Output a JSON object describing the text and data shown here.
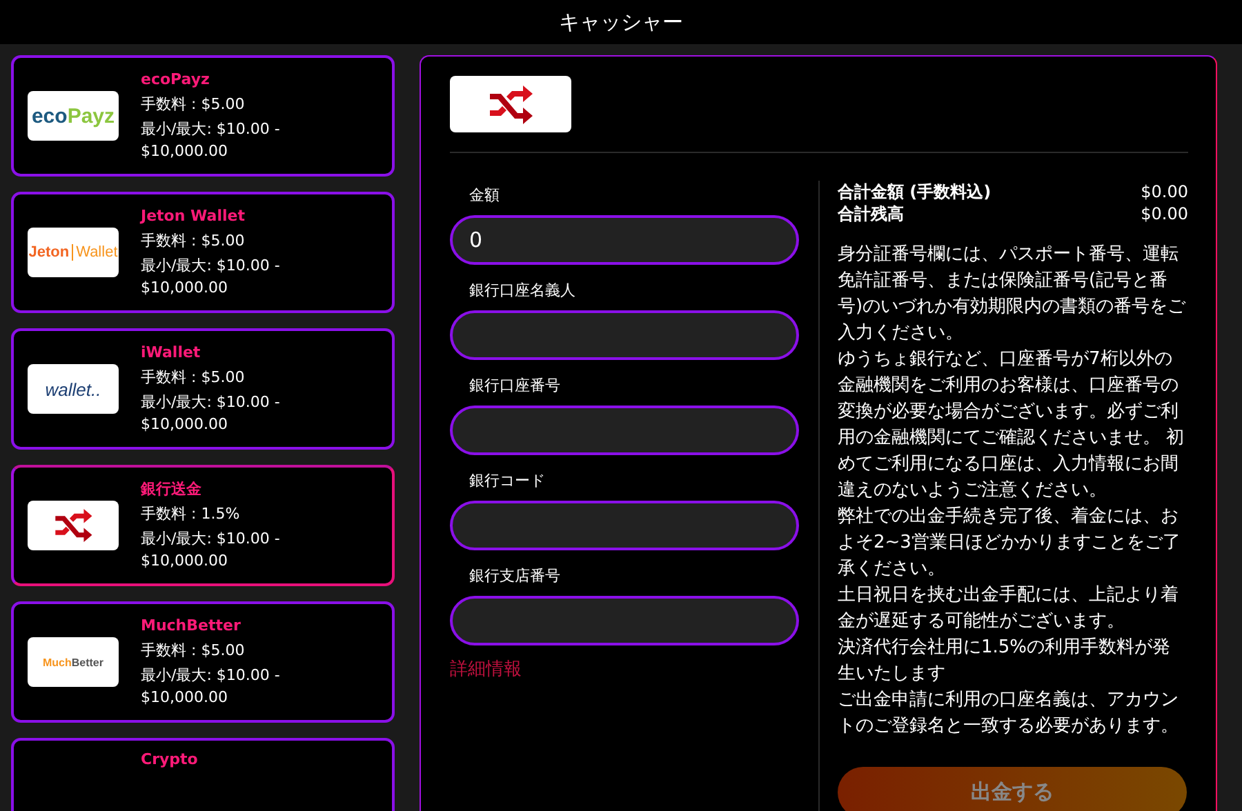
{
  "header": {
    "title": "キャッシャー"
  },
  "methods": [
    {
      "name": "ecoPayz",
      "fee": "手数料 : $5.00",
      "limits": "最小/最大: $10.00 - $10,000.00",
      "logo": {
        "kind": "ecopayz",
        "parts": [
          "eco",
          "Payz"
        ]
      },
      "selected": false
    },
    {
      "name": "Jeton Wallet",
      "fee": "手数料 : $5.00",
      "limits": "最小/最大: $10.00 - $10,000.00",
      "logo": {
        "kind": "jeton",
        "parts": [
          "Jeton",
          "Wallet"
        ]
      },
      "selected": false
    },
    {
      "name": "iWallet",
      "fee": "手数料 : $5.00",
      "limits": "最小/最大: $10.00 - $10,000.00",
      "logo": {
        "kind": "iwallet",
        "parts": [
          "wallet.."
        ]
      },
      "selected": false
    },
    {
      "name": "銀行送金",
      "fee": "手数料 : 1.5%",
      "limits": "最小/最大: $10.00 - $10,000.00",
      "logo": {
        "kind": "transfer"
      },
      "selected": true
    },
    {
      "name": "MuchBetter",
      "fee": "手数料 : $5.00",
      "limits": "最小/最大: $10.00 - $10,000.00",
      "logo": {
        "kind": "muchbetter",
        "parts": [
          "Much",
          "Better"
        ]
      },
      "selected": false
    },
    {
      "name": "Crypto",
      "selected": false
    }
  ],
  "form": {
    "fields": [
      {
        "label": "金額",
        "value": "0"
      },
      {
        "label": "銀行口座名義人"
      },
      {
        "label": "銀行口座番号"
      },
      {
        "label": "銀行コード"
      },
      {
        "label": "銀行支店番号"
      }
    ],
    "more_link": "詳細情報"
  },
  "summary": {
    "rows": [
      {
        "label": "合計金額 (手数料込)",
        "value": "$0.00"
      },
      {
        "label": "合計残高",
        "value": "$0.00"
      }
    ],
    "notes": [
      "身分証番号欄には、パスポート番号、運転免許証番号、または保険証番号(記号と番号)のいづれか有効期限内の書類の番号をご入力ください。",
      "ゆうちょ銀行など、口座番号が7桁以外の金融機関をご利用のお客様は、口座番号の変換が必要な場合がございます。必ずご利用の金融機関にてご確認くださいませ。 初めてご利用になる口座は、入力情報にお間違えのないようご注意ください。",
      "弊社での出金手続き完了後、着金には、およそ2~3営業日ほどかかりますことをご了承ください。",
      "土日祝日を挟む出金手配には、上記より着金が遅延する可能性がございます。",
      "決済代行会社用に1.5%の利用手数料が発生いたします",
      "ご出金申請に利用の口座名義は、アカウントのご登録名と一致する必要があります。"
    ],
    "submit": {
      "label": "出金する",
      "disabled": true
    }
  }
}
